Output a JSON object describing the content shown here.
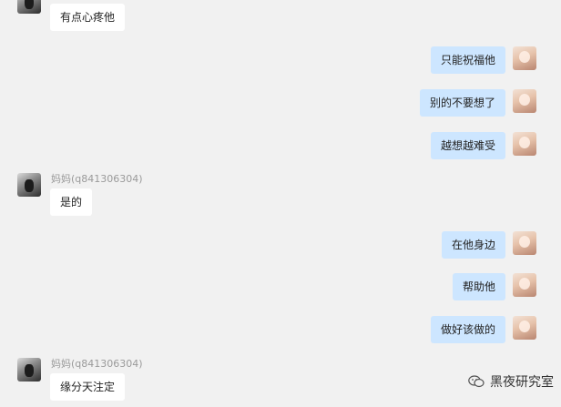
{
  "messages": [
    {
      "side": "other",
      "text": "有点心疼他"
    },
    {
      "side": "self",
      "text": "只能祝福他"
    },
    {
      "side": "self",
      "text": "别的不要想了"
    },
    {
      "side": "self",
      "text": "越想越难受"
    },
    {
      "side": "other",
      "sender": "妈妈(q841306304)",
      "text": "是的"
    },
    {
      "side": "self",
      "text": "在他身边"
    },
    {
      "side": "self",
      "text": "帮助他"
    },
    {
      "side": "self",
      "text": "做好该做的"
    },
    {
      "side": "other",
      "sender": "妈妈(q841306304)",
      "text": "缘分天注定"
    }
  ],
  "watermark": {
    "text": "黑夜研究室",
    "icon": "wechat-icon"
  },
  "colors": {
    "background": "#f1f1f1",
    "self_bubble": "#cde6ff",
    "other_bubble": "#ffffff",
    "sender_text": "#9a9a9a"
  }
}
